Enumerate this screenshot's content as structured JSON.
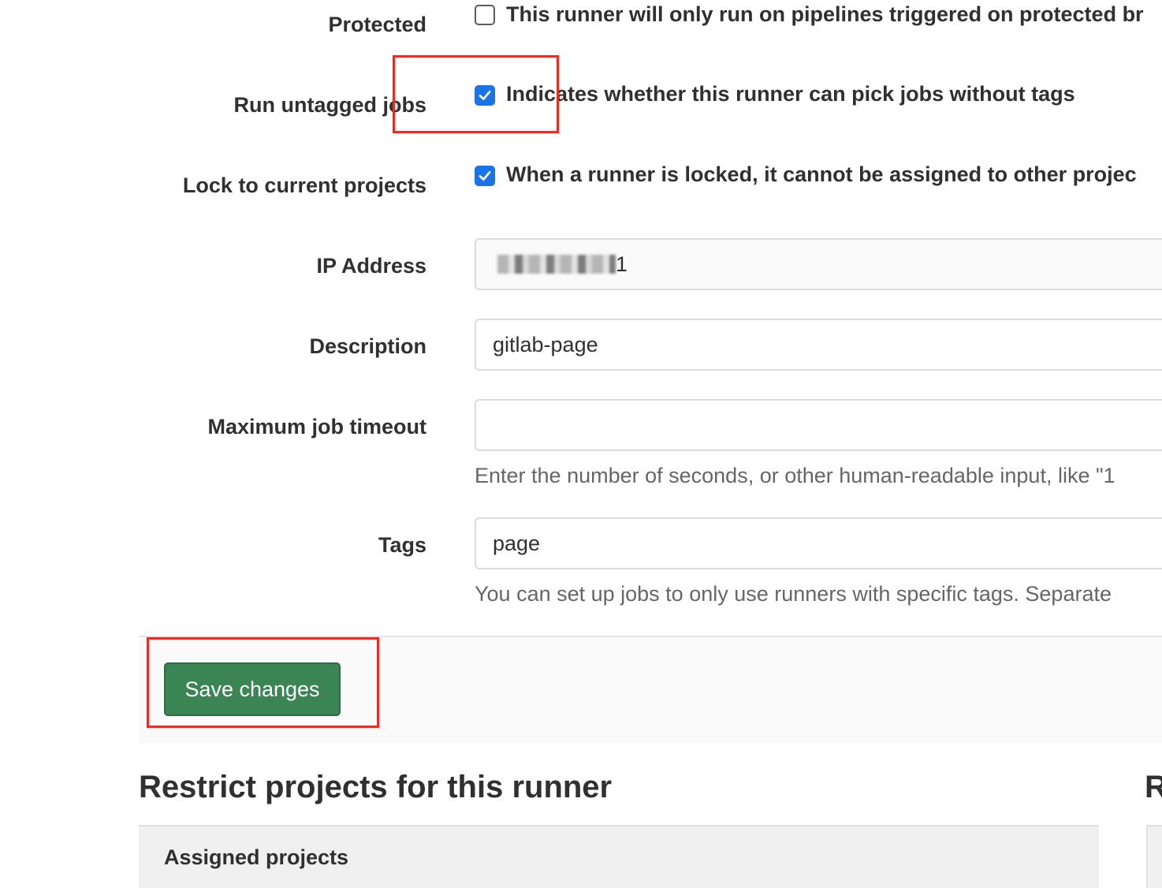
{
  "form": {
    "protected": {
      "label": "Protected",
      "checked": false,
      "description": "This runner will only run on pipelines triggered on protected br"
    },
    "run_untagged": {
      "label": "Run untagged jobs",
      "checked": true,
      "description": "Indicates whether this runner can pick jobs without tags"
    },
    "lock_projects": {
      "label": "Lock to current projects",
      "checked": true,
      "description": "When a runner is locked, it cannot be assigned to other projec"
    },
    "ip_address": {
      "label": "IP Address",
      "value_suffix": "1"
    },
    "description": {
      "label": "Description",
      "value": "gitlab-page"
    },
    "max_timeout": {
      "label": "Maximum job timeout",
      "value": "",
      "help": "Enter the number of seconds, or other human-readable input, like \"1"
    },
    "tags": {
      "label": "Tags",
      "value": "page",
      "help": "You can set up jobs to only use runners with specific tags. Separate"
    },
    "save_label": "Save changes"
  },
  "restrict": {
    "title": "Restrict projects for this runner",
    "title_right_fragment": "R",
    "assigned_header": "Assigned projects"
  },
  "colors": {
    "accent_blue": "#1a73e8",
    "save_green": "#3a8553",
    "highlight_red": "#e0302a"
  }
}
